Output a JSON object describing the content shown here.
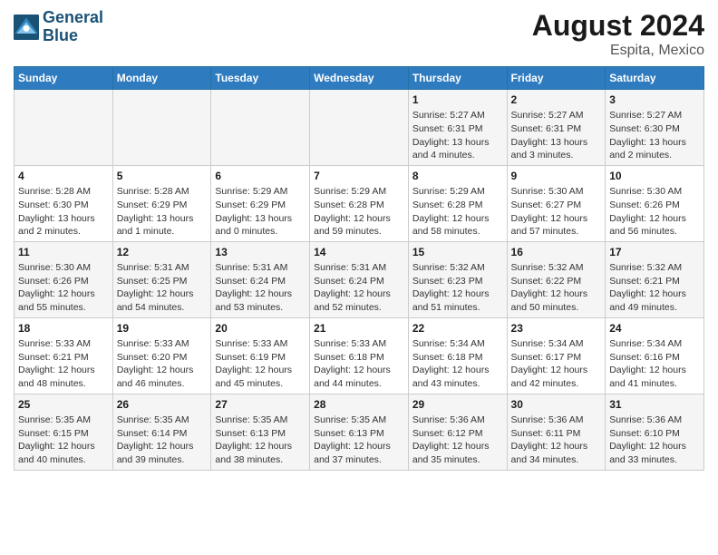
{
  "header": {
    "logo_line1": "General",
    "logo_line2": "Blue",
    "title": "August 2024",
    "subtitle": "Espita, Mexico"
  },
  "days_of_week": [
    "Sunday",
    "Monday",
    "Tuesday",
    "Wednesday",
    "Thursday",
    "Friday",
    "Saturday"
  ],
  "weeks": [
    [
      {
        "day": "",
        "info": ""
      },
      {
        "day": "",
        "info": ""
      },
      {
        "day": "",
        "info": ""
      },
      {
        "day": "",
        "info": ""
      },
      {
        "day": "1",
        "info": "Sunrise: 5:27 AM\nSunset: 6:31 PM\nDaylight: 13 hours\nand 4 minutes."
      },
      {
        "day": "2",
        "info": "Sunrise: 5:27 AM\nSunset: 6:31 PM\nDaylight: 13 hours\nand 3 minutes."
      },
      {
        "day": "3",
        "info": "Sunrise: 5:27 AM\nSunset: 6:30 PM\nDaylight: 13 hours\nand 2 minutes."
      }
    ],
    [
      {
        "day": "4",
        "info": "Sunrise: 5:28 AM\nSunset: 6:30 PM\nDaylight: 13 hours\nand 2 minutes."
      },
      {
        "day": "5",
        "info": "Sunrise: 5:28 AM\nSunset: 6:29 PM\nDaylight: 13 hours\nand 1 minute."
      },
      {
        "day": "6",
        "info": "Sunrise: 5:29 AM\nSunset: 6:29 PM\nDaylight: 13 hours\nand 0 minutes."
      },
      {
        "day": "7",
        "info": "Sunrise: 5:29 AM\nSunset: 6:28 PM\nDaylight: 12 hours\nand 59 minutes."
      },
      {
        "day": "8",
        "info": "Sunrise: 5:29 AM\nSunset: 6:28 PM\nDaylight: 12 hours\nand 58 minutes."
      },
      {
        "day": "9",
        "info": "Sunrise: 5:30 AM\nSunset: 6:27 PM\nDaylight: 12 hours\nand 57 minutes."
      },
      {
        "day": "10",
        "info": "Sunrise: 5:30 AM\nSunset: 6:26 PM\nDaylight: 12 hours\nand 56 minutes."
      }
    ],
    [
      {
        "day": "11",
        "info": "Sunrise: 5:30 AM\nSunset: 6:26 PM\nDaylight: 12 hours\nand 55 minutes."
      },
      {
        "day": "12",
        "info": "Sunrise: 5:31 AM\nSunset: 6:25 PM\nDaylight: 12 hours\nand 54 minutes."
      },
      {
        "day": "13",
        "info": "Sunrise: 5:31 AM\nSunset: 6:24 PM\nDaylight: 12 hours\nand 53 minutes."
      },
      {
        "day": "14",
        "info": "Sunrise: 5:31 AM\nSunset: 6:24 PM\nDaylight: 12 hours\nand 52 minutes."
      },
      {
        "day": "15",
        "info": "Sunrise: 5:32 AM\nSunset: 6:23 PM\nDaylight: 12 hours\nand 51 minutes."
      },
      {
        "day": "16",
        "info": "Sunrise: 5:32 AM\nSunset: 6:22 PM\nDaylight: 12 hours\nand 50 minutes."
      },
      {
        "day": "17",
        "info": "Sunrise: 5:32 AM\nSunset: 6:21 PM\nDaylight: 12 hours\nand 49 minutes."
      }
    ],
    [
      {
        "day": "18",
        "info": "Sunrise: 5:33 AM\nSunset: 6:21 PM\nDaylight: 12 hours\nand 48 minutes."
      },
      {
        "day": "19",
        "info": "Sunrise: 5:33 AM\nSunset: 6:20 PM\nDaylight: 12 hours\nand 46 minutes."
      },
      {
        "day": "20",
        "info": "Sunrise: 5:33 AM\nSunset: 6:19 PM\nDaylight: 12 hours\nand 45 minutes."
      },
      {
        "day": "21",
        "info": "Sunrise: 5:33 AM\nSunset: 6:18 PM\nDaylight: 12 hours\nand 44 minutes."
      },
      {
        "day": "22",
        "info": "Sunrise: 5:34 AM\nSunset: 6:18 PM\nDaylight: 12 hours\nand 43 minutes."
      },
      {
        "day": "23",
        "info": "Sunrise: 5:34 AM\nSunset: 6:17 PM\nDaylight: 12 hours\nand 42 minutes."
      },
      {
        "day": "24",
        "info": "Sunrise: 5:34 AM\nSunset: 6:16 PM\nDaylight: 12 hours\nand 41 minutes."
      }
    ],
    [
      {
        "day": "25",
        "info": "Sunrise: 5:35 AM\nSunset: 6:15 PM\nDaylight: 12 hours\nand 40 minutes."
      },
      {
        "day": "26",
        "info": "Sunrise: 5:35 AM\nSunset: 6:14 PM\nDaylight: 12 hours\nand 39 minutes."
      },
      {
        "day": "27",
        "info": "Sunrise: 5:35 AM\nSunset: 6:13 PM\nDaylight: 12 hours\nand 38 minutes."
      },
      {
        "day": "28",
        "info": "Sunrise: 5:35 AM\nSunset: 6:13 PM\nDaylight: 12 hours\nand 37 minutes."
      },
      {
        "day": "29",
        "info": "Sunrise: 5:36 AM\nSunset: 6:12 PM\nDaylight: 12 hours\nand 35 minutes."
      },
      {
        "day": "30",
        "info": "Sunrise: 5:36 AM\nSunset: 6:11 PM\nDaylight: 12 hours\nand 34 minutes."
      },
      {
        "day": "31",
        "info": "Sunrise: 5:36 AM\nSunset: 6:10 PM\nDaylight: 12 hours\nand 33 minutes."
      }
    ]
  ]
}
